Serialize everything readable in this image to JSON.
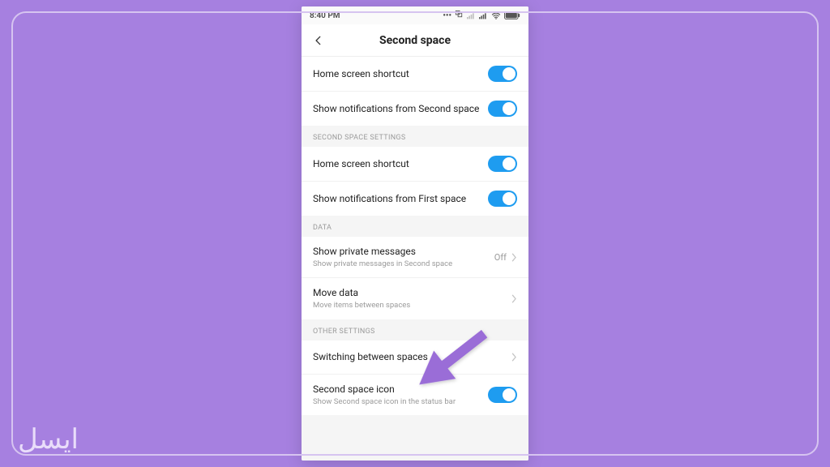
{
  "statusbar": {
    "time": "8:40 PM"
  },
  "header": {
    "title": "Second space"
  },
  "section_top": {
    "items": [
      {
        "label": "Home screen shortcut",
        "toggle": true
      },
      {
        "label": "Show notifications from Second space",
        "toggle": true
      }
    ]
  },
  "section_settings": {
    "heading": "SECOND SPACE SETTINGS",
    "items": [
      {
        "label": "Home screen shortcut",
        "toggle": true
      },
      {
        "label": "Show notifications from First space",
        "toggle": true
      }
    ]
  },
  "section_data": {
    "heading": "DATA",
    "items": [
      {
        "label": "Show private messages",
        "sub": "Show private messages in Second space",
        "value": "Off"
      },
      {
        "label": "Move data",
        "sub": "Move items between spaces"
      }
    ]
  },
  "section_other": {
    "heading": "OTHER SETTINGS",
    "items": [
      {
        "label": "Switching between spaces"
      },
      {
        "label": "Second space icon",
        "sub": "Show Second space icon in the status bar",
        "toggle": true
      }
    ]
  },
  "watermark": "ایسل",
  "colors": {
    "accent": "#1e9cf0",
    "bg": "#a680e0",
    "arrow": "#8a5cd6"
  }
}
